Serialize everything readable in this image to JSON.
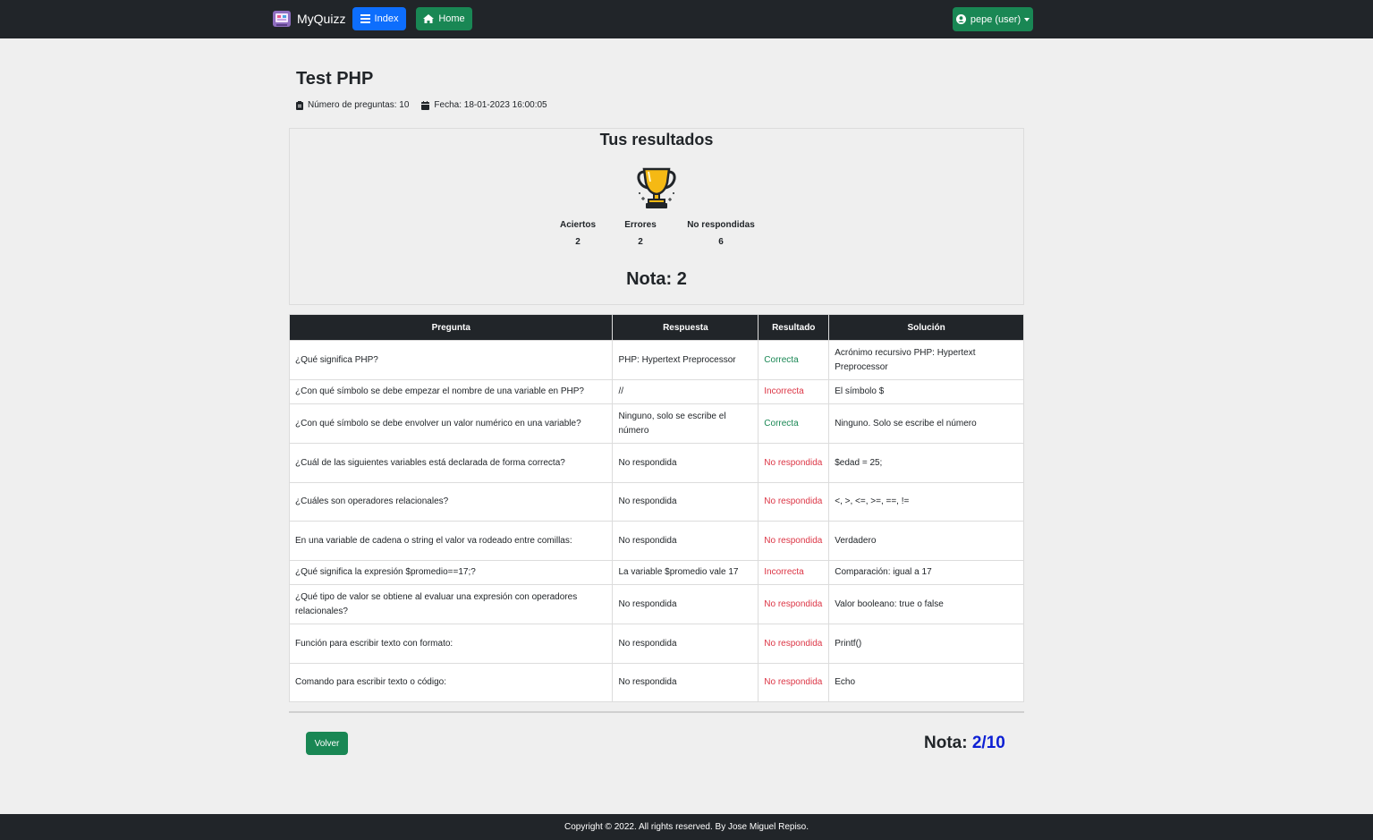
{
  "navbar": {
    "brand": "MyQuizz",
    "index_label": "Index",
    "home_label": "Home",
    "user_label": "pepe (user)"
  },
  "quiz": {
    "title": "Test PHP",
    "num_questions": "Número de preguntas: 10",
    "date": "Fecha: 18-01-2023 16:00:05"
  },
  "results": {
    "title": "Tus resultados",
    "aciertos_label": "Aciertos",
    "aciertos": "2",
    "errores_label": "Errores",
    "errores": "2",
    "no_resp_label": "No respondidas",
    "no_resp": "6",
    "nota": "Nota: 2"
  },
  "table": {
    "headers": [
      "Pregunta",
      "Respuesta",
      "Resultado",
      "Solución"
    ],
    "rows": [
      {
        "q": "¿Qué significa PHP?",
        "a": "PHP: Hypertext Preprocessor",
        "r": "Correcta",
        "s": "Acrónimo recursivo PHP: Hypertext Preprocessor"
      },
      {
        "q": "¿Con qué símbolo se debe empezar el nombre de una variable en PHP?",
        "a": "//",
        "r": "Incorrecta",
        "s": "El símbolo $"
      },
      {
        "q": "¿Con qué símbolo se debe envolver un valor numérico en una variable?",
        "a": "Ninguno, solo se escribe el número",
        "r": "Correcta",
        "s": "Ninguno. Solo se escribe el número"
      },
      {
        "q": "¿Cuál de las siguientes variables está declarada de forma correcta?",
        "a": "No respondida",
        "r": "No respondida",
        "s": "$edad = 25;"
      },
      {
        "q": "¿Cuáles son operadores relacionales?",
        "a": "No respondida",
        "r": "No respondida",
        "s": "<, >, <=, >=, ==, !="
      },
      {
        "q": "En una variable de cadena o string el valor va rodeado entre comillas:",
        "a": "No respondida",
        "r": "No respondida",
        "s": "Verdadero"
      },
      {
        "q": "¿Qué significa la expresión $promedio==17;?",
        "a": "La variable $promedio vale 17",
        "r": "Incorrecta",
        "s": "Comparación: igual a 17"
      },
      {
        "q": "¿Qué tipo de valor se obtiene al evaluar una expresión con operadores relacionales?",
        "a": "No respondida",
        "r": "No respondida",
        "s": "Valor booleano: true o false"
      },
      {
        "q": "Función para escribir texto con formato:",
        "a": "No respondida",
        "r": "No respondida",
        "s": "Printf()"
      },
      {
        "q": "Comando para escribir texto o código:",
        "a": "No respondida",
        "r": "No respondida",
        "s": "Echo"
      }
    ]
  },
  "bottom": {
    "volver_label": "Volver",
    "nota_label": "Nota:",
    "nota_score": "2/10"
  },
  "footer": {
    "text": "Copyright © 2022. All rights reserved. By Jose Miguel Repiso."
  },
  "colors": {
    "navbar": "#212529",
    "primary": "#0d6efd",
    "success": "#198754",
    "danger": "#dc3545",
    "score": "#0d20d4"
  }
}
